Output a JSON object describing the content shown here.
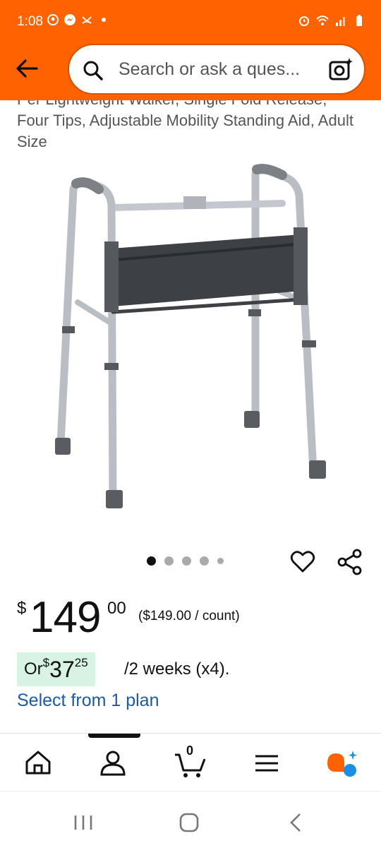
{
  "status_bar": {
    "time": "1:08"
  },
  "search": {
    "placeholder": "Search or ask a ques..."
  },
  "product": {
    "title_cut": "Per Lightweight Walker, Single Fold Release,",
    "title_lines": "Four Tips, Adjustable Mobility Standing Aid, Adult Size",
    "image_count": 5,
    "active_image_index": 0
  },
  "price": {
    "symbol": "$",
    "whole": "149",
    "fraction": "00",
    "unit": "($149.00 / count)"
  },
  "installment": {
    "prefix": "Or ",
    "symbol": "$",
    "whole": "37",
    "fraction": "25",
    "rest": "/2 weeks (x4)."
  },
  "select_plan": "Select from 1 plan",
  "nav": {
    "cart_count": "0"
  },
  "colors": {
    "brand": "#ff6200",
    "link": "#1d5aa8",
    "install_bg": "#d8f3e4"
  }
}
